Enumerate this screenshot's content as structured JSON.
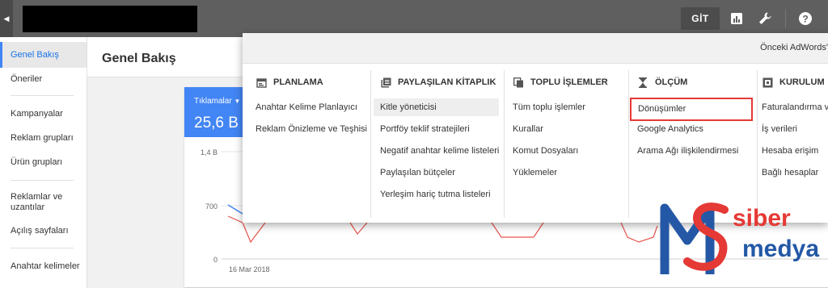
{
  "topbar": {
    "collapse_icon": "caret-left-icon",
    "git_label": "GİT"
  },
  "sidebar": {
    "items": [
      "Genel Bakış",
      "Öneriler",
      "Kampanyalar",
      "Reklam grupları",
      "Ürün grupları",
      "Reklamlar ve uzantılar",
      "Açılış sayfaları",
      "Anahtar kelimeler"
    ]
  },
  "page": {
    "title": "Genel Bakış"
  },
  "metric": {
    "label": "Tıklamalar",
    "value": "25,6 B"
  },
  "chart_data": {
    "type": "line",
    "yticks": [
      "1,4 B",
      "700",
      "0"
    ],
    "xlabel_start": "16 Mar 2018"
  },
  "menu": {
    "topbar_label": "Önceki AdWords'",
    "columns": [
      {
        "icon": "calendar-icon",
        "title": "PLANLAMA",
        "links": [
          "Anahtar Kelime Planlayıcı",
          "Reklam Önizleme ve Teşhisi"
        ]
      },
      {
        "icon": "library-icon",
        "title": "PAYLAŞILAN KİTAPLIK",
        "links": [
          "Kitle yöneticisi",
          "Portföy teklif stratejileri",
          "Negatif anahtar kelime listeleri",
          "Paylaşılan bütçeler",
          "Yerleşim hariç tutma listeleri"
        ]
      },
      {
        "icon": "copy-icon",
        "title": "TOPLU İŞLEMLER",
        "links": [
          "Tüm toplu işlemler",
          "Kurallar",
          "Komut Dosyaları",
          "Yüklemeler"
        ]
      },
      {
        "icon": "hourglass-icon",
        "title": "ÖLÇÜM",
        "links": [
          "Dönüşümler",
          "Google Analytics",
          "Arama Ağı ilişkilendirmesi"
        ]
      },
      {
        "icon": "setup-icon",
        "title": "KURULUM",
        "links": [
          "Faturalandırma ve",
          "İş verileri",
          "Hesaba erişim",
          "Bağlı hesaplar"
        ]
      }
    ]
  },
  "watermark": {
    "line1": "siber",
    "line2": "medya"
  }
}
